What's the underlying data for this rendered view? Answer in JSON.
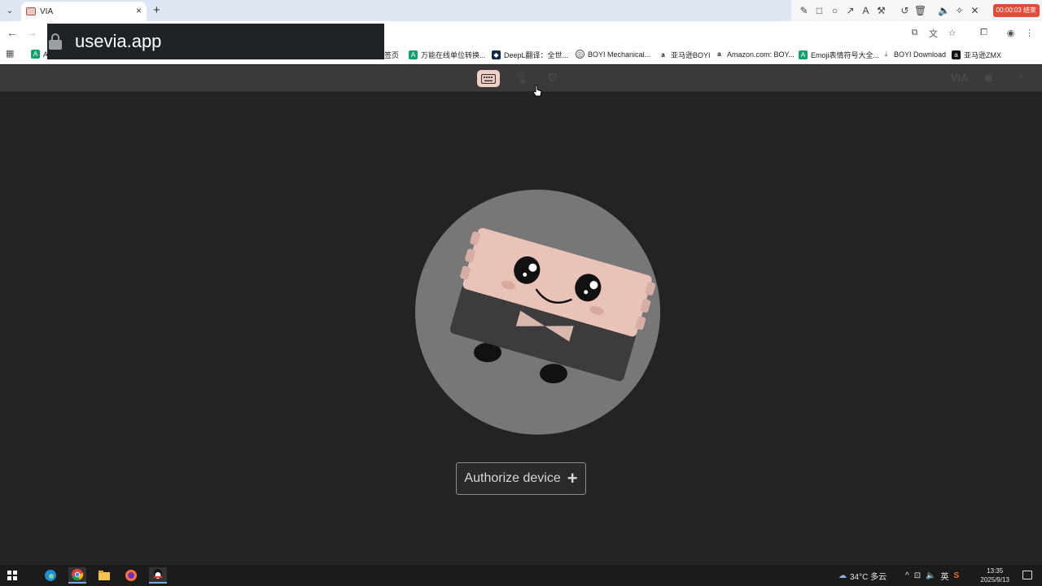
{
  "browser": {
    "tab": {
      "title": "VIA"
    },
    "url": "usevia.app",
    "bookmarks": [
      {
        "label": "万能在线单位转换...",
        "color": "#12a36b"
      },
      {
        "label": "DeepL翻译：全世...",
        "color": "#0f2b46"
      },
      {
        "label": "BOYI Mechanical...",
        "color": "#555555"
      },
      {
        "label": "亚马逊BOYI",
        "color": "#ff9900"
      },
      {
        "label": "Amazon.com: BOY...",
        "color": "#ff9900"
      },
      {
        "label": "Emoji表情符号大全...",
        "color": "#12a36b"
      },
      {
        "label": "BOYI Download",
        "color": "#555555"
      },
      {
        "label": "亚马逊ZMX",
        "color": "#111111"
      }
    ],
    "bookmark_partial_left": "A",
    "bookmark_partial_mid": "签页"
  },
  "recorder": {
    "timer": "00:00:03 结束"
  },
  "via": {
    "header_right_text": "VIA",
    "authorize_label": "Authorize device",
    "authorize_icon": "plus-icon"
  },
  "taskbar": {
    "weather": "34°C 多云",
    "ime": "英",
    "time": "13:35",
    "date": "2025/9/13"
  },
  "colors": {
    "app_bg": "#232323",
    "header_bg": "#3a3a3a",
    "accent_pink": "#f3d0c7",
    "circle": "#777777"
  }
}
